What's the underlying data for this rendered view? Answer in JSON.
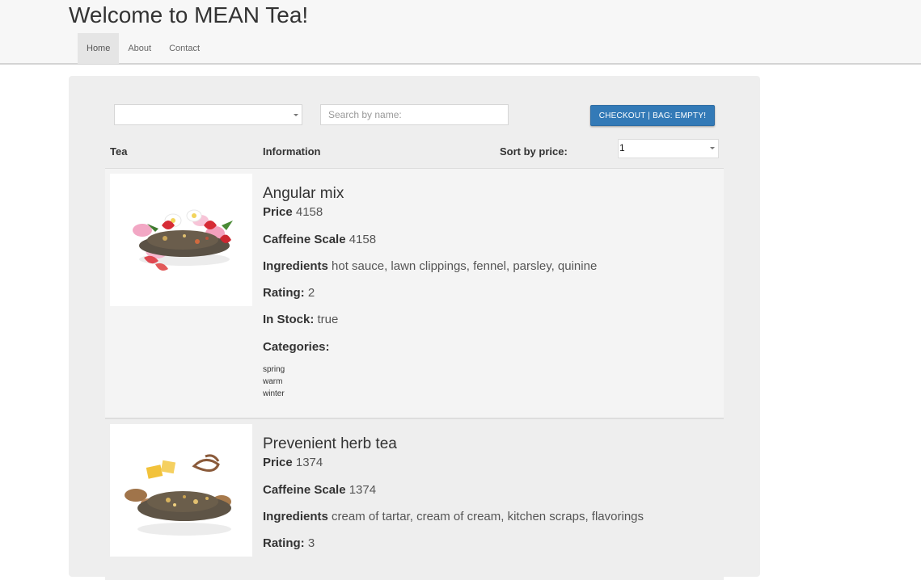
{
  "header": {
    "title": "Welcome to MEAN Tea!",
    "nav": [
      {
        "label": "Home",
        "active": true
      },
      {
        "label": "About",
        "active": false
      },
      {
        "label": "Contact",
        "active": false
      }
    ]
  },
  "toolbar": {
    "category_value": "",
    "search_placeholder": "Search by name:",
    "checkout_label": "CHECKOUT | BAG: EMPTY!"
  },
  "table": {
    "headers": {
      "tea": "Tea",
      "information": "Information",
      "sort": "Sort by price:"
    },
    "sort_value": "1"
  },
  "labels": {
    "price": "Price",
    "caffeine": "Caffeine Scale",
    "ingredients": "Ingredients",
    "rating": "Rating:",
    "in_stock": "In Stock:",
    "categories": "Categories:"
  },
  "teas": [
    {
      "name": "Angular mix",
      "price": "4158",
      "caffeine": "4158",
      "ingredients": "hot sauce, lawn clippings, fennel, parsley, quinine",
      "rating": "2",
      "in_stock": "true",
      "categories": [
        "spring",
        "warm",
        "winter"
      ],
      "image_icon": "tea-blend-strawberry-image"
    },
    {
      "name": "Prevenient herb tea",
      "price": "1374",
      "caffeine": "1374",
      "ingredients": "cream of tartar, cream of cream, kitchen scraps, flavorings",
      "rating": "3",
      "image_icon": "tea-blend-coconut-image"
    }
  ],
  "colors": {
    "primary_button": "#337ab7",
    "panel": "#eeeeee",
    "navbar": "#f7f7f7"
  }
}
